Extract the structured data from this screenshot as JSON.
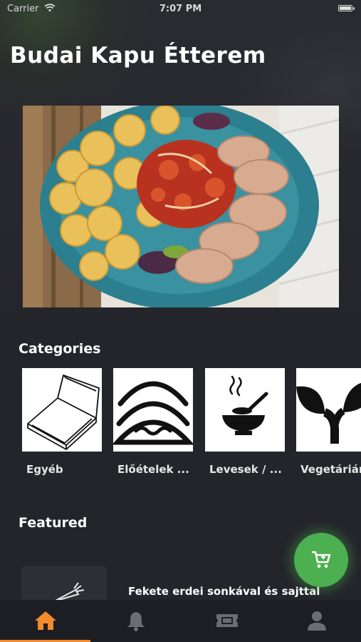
{
  "status_bar": {
    "carrier": "Carrier",
    "time": "7:07 PM"
  },
  "header": {
    "title": "Budai Kapu Étterem"
  },
  "categories": {
    "heading": "Categories",
    "items": [
      {
        "label": "Egyéb",
        "icon": "pizza-box-icon"
      },
      {
        "label": "Előételek ...",
        "icon": "tacos-icon"
      },
      {
        "label": "Levesek / ...",
        "icon": "soup-bowl-icon"
      },
      {
        "label": "Vegetárián",
        "icon": "sprout-icon"
      }
    ]
  },
  "featured": {
    "heading": "Featured",
    "items": [
      {
        "name": "Fekete erdei sonkával és sajttal"
      }
    ]
  },
  "tabs": [
    {
      "name": "home",
      "icon": "home-icon",
      "active": true
    },
    {
      "name": "notifications",
      "icon": "bell-icon",
      "active": false
    },
    {
      "name": "tickets",
      "icon": "ticket-icon",
      "active": false
    },
    {
      "name": "profile",
      "icon": "person-icon",
      "active": false
    }
  ],
  "colors": {
    "background": "#24252b",
    "accent": "#f28a2e",
    "cart_button": "#4caf50",
    "tab_bar": "#1d1e23"
  }
}
